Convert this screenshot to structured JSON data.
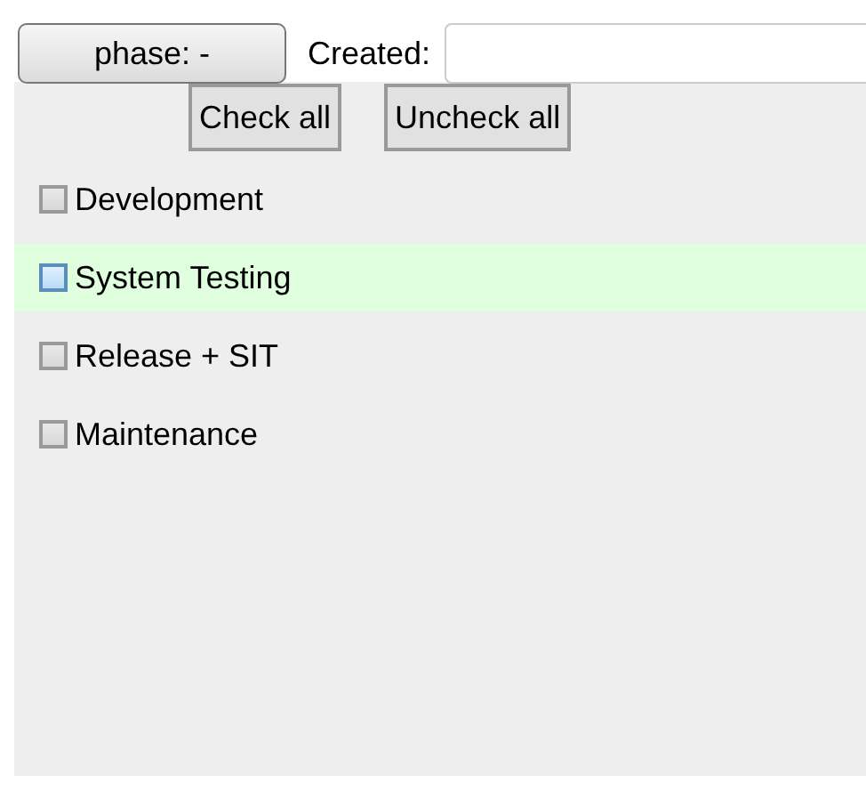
{
  "phase_button": {
    "label": "phase: -"
  },
  "created": {
    "label": "Created:"
  },
  "buttons": [
    "Check all",
    "Uncheck all"
  ],
  "phases": [
    {
      "label": "Development",
      "checked": false,
      "highlighted": false
    },
    {
      "label": "System Testing",
      "checked": false,
      "highlighted": true
    },
    {
      "label": "Release + SIT",
      "checked": false,
      "highlighted": false
    },
    {
      "label": "Maintenance",
      "checked": false,
      "highlighted": false
    }
  ]
}
